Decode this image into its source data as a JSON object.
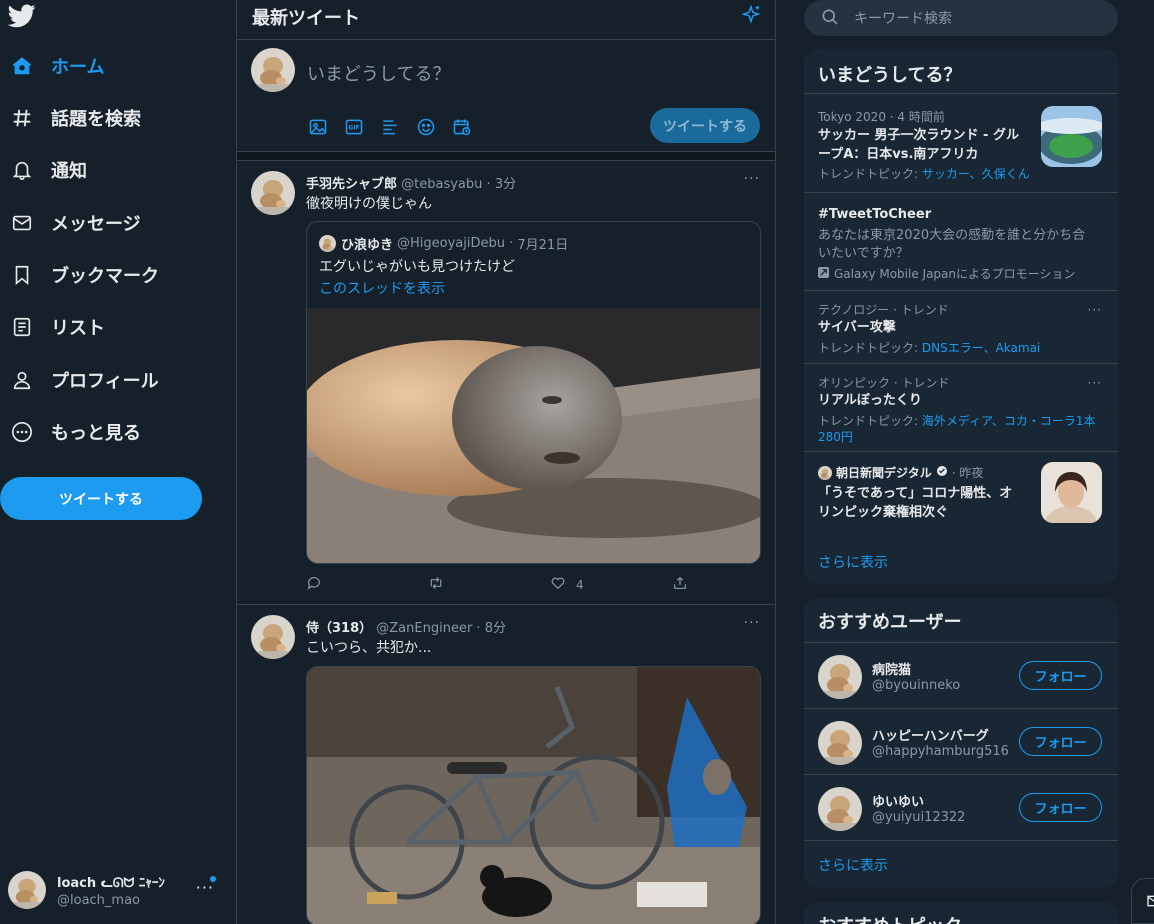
{
  "colors": {
    "accent": "#1d9bf0",
    "background": "#15202b",
    "panel": "#192734",
    "border": "#38444d",
    "muted": "#8b98a5"
  },
  "nav": {
    "items": [
      {
        "label": "ホーム",
        "icon": "home-icon"
      },
      {
        "label": "話題を検索",
        "icon": "hashtag-icon"
      },
      {
        "label": "通知",
        "icon": "bell-icon"
      },
      {
        "label": "メッセージ",
        "icon": "mail-icon"
      },
      {
        "label": "ブックマーク",
        "icon": "bookmark-icon"
      },
      {
        "label": "リスト",
        "icon": "list-icon"
      },
      {
        "label": "プロフィール",
        "icon": "person-icon"
      },
      {
        "label": "もっと見る",
        "icon": "more-circle-icon"
      }
    ],
    "tweet_button": "ツイートする"
  },
  "account": {
    "name": "loach ᓚᘏᗢ ﾆｬｰﾝ",
    "handle": "@loach_mao"
  },
  "main": {
    "title": "最新ツイート",
    "compose": {
      "placeholder": "いまどうしてる？",
      "submit": "ツイートする"
    }
  },
  "tweets": [
    {
      "name": "手羽先シャブ郎",
      "handle": "@tebasyabu",
      "time": "3分",
      "text": "徹夜明けの僕じゃん",
      "quote": {
        "name": "ひ浪ゆき",
        "handle": "@HigeoyajiDebu",
        "date": "7月21日",
        "text": "エグいじゃがいも見つけたけど",
        "link": "このスレッドを表示"
      },
      "likes": "4"
    },
    {
      "name": "侍（318）",
      "handle": "@ZanEngineer",
      "time": "8分",
      "text": "こいつら、共犯か..."
    }
  ],
  "search": {
    "placeholder": "キーワード検索"
  },
  "trends": {
    "title": "いまどうしてる？",
    "items": [
      {
        "meta": "Tokyo 2020 · 4 時間前",
        "headline": "サッカー 男子一次ラウンド - グル\nープA：日本vs.南アフリカ",
        "sub_prefix": "トレンドトピック: ",
        "sub_links": "サッカー、久保くん"
      },
      {
        "headline": "#TweetToCheer",
        "body": "あなたは東京2020大会の感動を誰と分かち合\nいたいですか？",
        "promo": "Galaxy Mobile Japanによるプロモーション"
      },
      {
        "meta": "テクノロジー · トレンド",
        "headline": "サイバー攻撃",
        "sub_prefix": "トレンドトピック: ",
        "sub_links": "DNSエラー、Akamai"
      },
      {
        "meta": "オリンピック · トレンド",
        "headline": "リアルぼったくり",
        "sub_prefix": "トレンドトピック: ",
        "sub_links": "海外メディア、コカ・コーラ1本\n280円"
      },
      {
        "source": "朝日新聞デジタル",
        "time": "· 昨夜",
        "headline": "「うそであって」コロナ陽性、オ\nリンピック棄権相次ぐ"
      }
    ],
    "show_more": "さらに表示"
  },
  "who_to_follow": {
    "title": "おすすめユーザー",
    "users": [
      {
        "name": "病院猫",
        "handle": "@byouinneko"
      },
      {
        "name": "ハッピーハンバーグ",
        "handle": "@happyhamburg516"
      },
      {
        "name": "ゆいゆい",
        "handle": "@yuiyui12322"
      }
    ],
    "follow_label": "フォロー",
    "show_more": "さらに表示"
  },
  "topics": {
    "title": "おすすめトピック"
  }
}
